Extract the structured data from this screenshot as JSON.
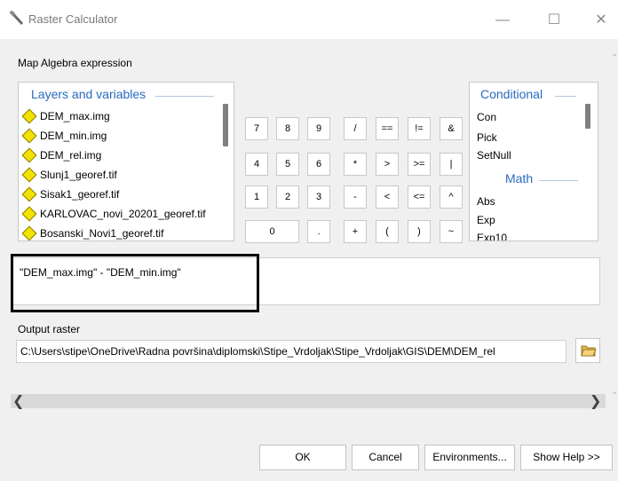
{
  "window": {
    "title": "Raster Calculator",
    "minimize": "—",
    "maximize": "☐",
    "close": "✕"
  },
  "expression_label": "Map Algebra expression",
  "layers": {
    "header": "Layers and variables",
    "items": [
      "DEM_max.img",
      "DEM_min.img",
      "DEM_rel.img",
      "Slunj1_georef.tif",
      "Sisak1_georef.tif",
      "KARLOVAC_novi_20201_georef.tif",
      "Bosanski_Novi1_georef.tif"
    ]
  },
  "keypad": {
    "row1": [
      "7",
      "8",
      "9",
      "/",
      "==",
      "!=",
      "&"
    ],
    "row2": [
      "4",
      "5",
      "6",
      "*",
      ">",
      ">=",
      "|"
    ],
    "row3": [
      "1",
      "2",
      "3",
      "-",
      "<",
      "<=",
      "^"
    ],
    "row4": [
      "0",
      ".",
      "+",
      "(",
      ")",
      "~"
    ]
  },
  "functions": {
    "header_conditional": "Conditional",
    "conditional": [
      "Con",
      "Pick",
      "SetNull"
    ],
    "header_math": "Math",
    "math": [
      "Abs",
      "Exp",
      "Exp10"
    ]
  },
  "expression": "\"DEM_max.img\" - \"DEM_min.img\"",
  "output": {
    "label": "Output raster",
    "value": "C:\\Users\\stipe\\OneDrive\\Radna površina\\diplomski\\Stipe_Vrdoljak\\Stipe_Vrdoljak\\GIS\\DEM\\DEM_rel"
  },
  "buttons": {
    "ok": "OK",
    "cancel": "Cancel",
    "environments": "Environments...",
    "show_help": "Show Help >>"
  },
  "colors": {
    "accent": "#2a6ac0",
    "layer_icon": "#f2e200",
    "highlight_border": "#000000"
  }
}
